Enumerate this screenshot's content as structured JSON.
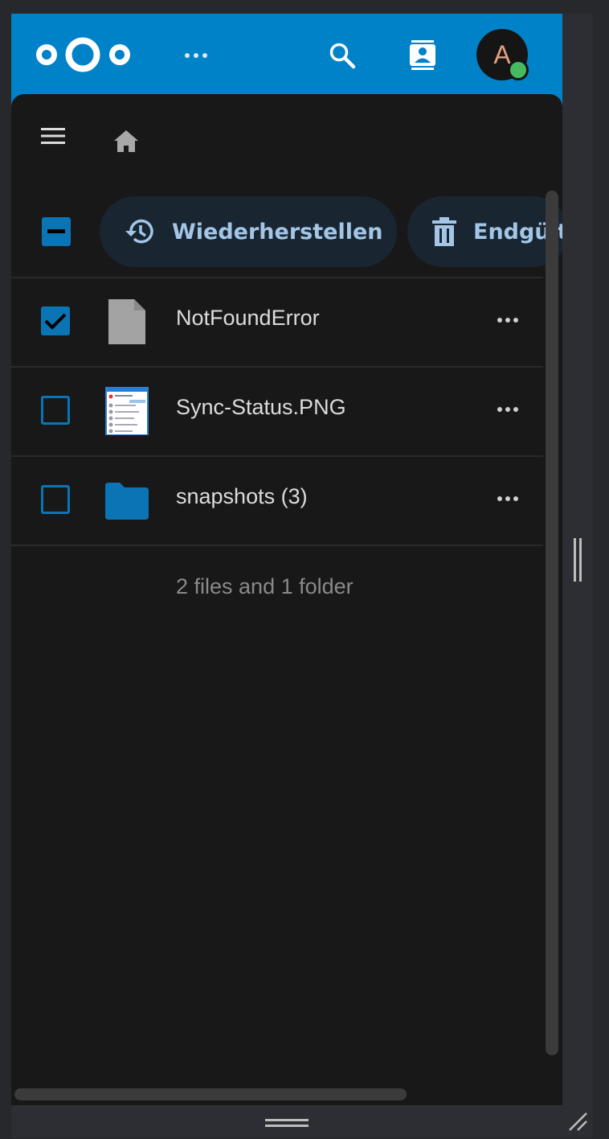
{
  "header": {
    "avatar_initial": "A",
    "brand_color": "#0082c9",
    "status_color": "#46ba61"
  },
  "actions": {
    "restore_label": "Wiederherstellen",
    "delete_label": "Endgültig löschen"
  },
  "files": [
    {
      "name": "NotFoundError",
      "selected": true,
      "type": "file"
    },
    {
      "name": "Sync-Status.PNG",
      "selected": false,
      "type": "image"
    },
    {
      "name": "snapshots (3)",
      "selected": false,
      "type": "folder"
    }
  ],
  "summary": "2 files and 1 folder"
}
